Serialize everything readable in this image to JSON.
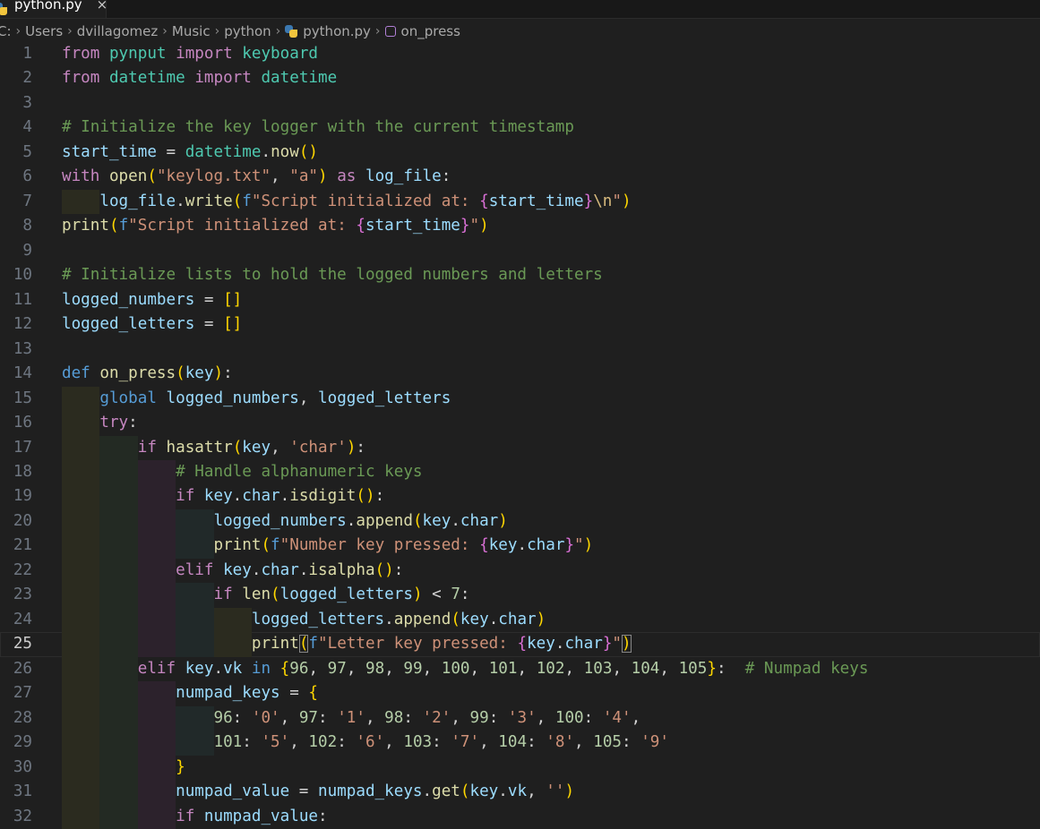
{
  "tab": {
    "label": "python.py",
    "close": "×"
  },
  "breadcrumb": [
    "C:",
    "Users",
    "dvillagomez",
    "Music",
    "python",
    "python.py",
    "on_press"
  ],
  "current_line": 25,
  "indent_colors": [
    "#2b2b1f",
    "#232a23",
    "#2c222c",
    "#212929"
  ],
  "lines": [
    [
      [
        "k",
        "from"
      ],
      [
        "p",
        " "
      ],
      [
        "m",
        "pynput"
      ],
      [
        "p",
        " "
      ],
      [
        "k",
        "import"
      ],
      [
        "p",
        " "
      ],
      [
        "m",
        "keyboard"
      ]
    ],
    [
      [
        "k",
        "from"
      ],
      [
        "p",
        " "
      ],
      [
        "m",
        "datetime"
      ],
      [
        "p",
        " "
      ],
      [
        "k",
        "import"
      ],
      [
        "p",
        " "
      ],
      [
        "m",
        "datetime"
      ]
    ],
    [],
    [
      [
        "c",
        "# Initialize the key logger with the current timestamp"
      ]
    ],
    [
      [
        "v",
        "start_time"
      ],
      [
        "p",
        " = "
      ],
      [
        "m",
        "datetime"
      ],
      [
        "p",
        "."
      ],
      [
        "f",
        "now"
      ],
      [
        "b1",
        "()"
      ]
    ],
    [
      [
        "k",
        "with"
      ],
      [
        "p",
        " "
      ],
      [
        "f",
        "open"
      ],
      [
        "b1",
        "("
      ],
      [
        "s",
        "\"keylog.txt\""
      ],
      [
        "p",
        ", "
      ],
      [
        "s",
        "\"a\""
      ],
      [
        "b1",
        ")"
      ],
      [
        "p",
        " "
      ],
      [
        "k",
        "as"
      ],
      [
        "p",
        " "
      ],
      [
        "v",
        "log_file"
      ],
      [
        "p",
        ":"
      ]
    ],
    [
      [
        "p",
        "    "
      ],
      [
        "v",
        "log_file"
      ],
      [
        "p",
        "."
      ],
      [
        "f",
        "write"
      ],
      [
        "b1",
        "("
      ],
      [
        "d",
        "f"
      ],
      [
        "s",
        "\"Script initialized at: "
      ],
      [
        "b2",
        "{"
      ],
      [
        "v",
        "start_time"
      ],
      [
        "b2",
        "}"
      ],
      [
        "e",
        "\\n"
      ],
      [
        "s",
        "\""
      ],
      [
        "b1",
        ")"
      ]
    ],
    [
      [
        "f",
        "print"
      ],
      [
        "b1",
        "("
      ],
      [
        "d",
        "f"
      ],
      [
        "s",
        "\"Script initialized at: "
      ],
      [
        "b2",
        "{"
      ],
      [
        "v",
        "start_time"
      ],
      [
        "b2",
        "}"
      ],
      [
        "s",
        "\""
      ],
      [
        "b1",
        ")"
      ]
    ],
    [],
    [
      [
        "c",
        "# Initialize lists to hold the logged numbers and letters"
      ]
    ],
    [
      [
        "v",
        "logged_numbers"
      ],
      [
        "p",
        " = "
      ],
      [
        "b1",
        "[]"
      ]
    ],
    [
      [
        "v",
        "logged_letters"
      ],
      [
        "p",
        " = "
      ],
      [
        "b1",
        "[]"
      ]
    ],
    [],
    [
      [
        "d",
        "def"
      ],
      [
        "p",
        " "
      ],
      [
        "f",
        "on_press"
      ],
      [
        "b1",
        "("
      ],
      [
        "v",
        "key"
      ],
      [
        "b1",
        ")"
      ],
      [
        "p",
        ":"
      ]
    ],
    [
      [
        "p",
        "    "
      ],
      [
        "d",
        "global"
      ],
      [
        "p",
        " "
      ],
      [
        "v",
        "logged_numbers"
      ],
      [
        "p",
        ", "
      ],
      [
        "v",
        "logged_letters"
      ]
    ],
    [
      [
        "p",
        "    "
      ],
      [
        "k",
        "try"
      ],
      [
        "p",
        ":"
      ]
    ],
    [
      [
        "p",
        "        "
      ],
      [
        "k",
        "if"
      ],
      [
        "p",
        " "
      ],
      [
        "f",
        "hasattr"
      ],
      [
        "b1",
        "("
      ],
      [
        "v",
        "key"
      ],
      [
        "p",
        ", "
      ],
      [
        "s",
        "'char'"
      ],
      [
        "b1",
        ")"
      ],
      [
        "p",
        ":"
      ]
    ],
    [
      [
        "p",
        "            "
      ],
      [
        "c",
        "# Handle alphanumeric keys"
      ]
    ],
    [
      [
        "p",
        "            "
      ],
      [
        "k",
        "if"
      ],
      [
        "p",
        " "
      ],
      [
        "v",
        "key"
      ],
      [
        "p",
        "."
      ],
      [
        "v",
        "char"
      ],
      [
        "p",
        "."
      ],
      [
        "f",
        "isdigit"
      ],
      [
        "b1",
        "()"
      ],
      [
        "p",
        ":"
      ]
    ],
    [
      [
        "p",
        "                "
      ],
      [
        "v",
        "logged_numbers"
      ],
      [
        "p",
        "."
      ],
      [
        "f",
        "append"
      ],
      [
        "b1",
        "("
      ],
      [
        "v",
        "key"
      ],
      [
        "p",
        "."
      ],
      [
        "v",
        "char"
      ],
      [
        "b1",
        ")"
      ]
    ],
    [
      [
        "p",
        "                "
      ],
      [
        "f",
        "print"
      ],
      [
        "b1",
        "("
      ],
      [
        "d",
        "f"
      ],
      [
        "s",
        "\"Number key pressed: "
      ],
      [
        "b2",
        "{"
      ],
      [
        "v",
        "key"
      ],
      [
        "p",
        "."
      ],
      [
        "v",
        "char"
      ],
      [
        "b2",
        "}"
      ],
      [
        "s",
        "\""
      ],
      [
        "b1",
        ")"
      ]
    ],
    [
      [
        "p",
        "            "
      ],
      [
        "k",
        "elif"
      ],
      [
        "p",
        " "
      ],
      [
        "v",
        "key"
      ],
      [
        "p",
        "."
      ],
      [
        "v",
        "char"
      ],
      [
        "p",
        "."
      ],
      [
        "f",
        "isalpha"
      ],
      [
        "b1",
        "()"
      ],
      [
        "p",
        ":"
      ]
    ],
    [
      [
        "p",
        "                "
      ],
      [
        "k",
        "if"
      ],
      [
        "p",
        " "
      ],
      [
        "f",
        "len"
      ],
      [
        "b1",
        "("
      ],
      [
        "v",
        "logged_letters"
      ],
      [
        "b1",
        ")"
      ],
      [
        "p",
        " < "
      ],
      [
        "n",
        "7"
      ],
      [
        "p",
        ":"
      ]
    ],
    [
      [
        "p",
        "                    "
      ],
      [
        "v",
        "logged_letters"
      ],
      [
        "p",
        "."
      ],
      [
        "f",
        "append"
      ],
      [
        "b1",
        "("
      ],
      [
        "v",
        "key"
      ],
      [
        "p",
        "."
      ],
      [
        "v",
        "char"
      ],
      [
        "b1",
        ")"
      ]
    ],
    [
      [
        "p",
        "                    "
      ],
      [
        "f",
        "print"
      ],
      [
        "b1m",
        "("
      ],
      [
        "d",
        "f"
      ],
      [
        "s",
        "\"Letter key pressed: "
      ],
      [
        "b2",
        "{"
      ],
      [
        "v",
        "key"
      ],
      [
        "p",
        "."
      ],
      [
        "v",
        "char"
      ],
      [
        "b2",
        "}"
      ],
      [
        "s",
        "\""
      ],
      [
        "b1m",
        ")"
      ]
    ],
    [
      [
        "p",
        "        "
      ],
      [
        "k",
        "elif"
      ],
      [
        "p",
        " "
      ],
      [
        "v",
        "key"
      ],
      [
        "p",
        "."
      ],
      [
        "v",
        "vk"
      ],
      [
        "p",
        " "
      ],
      [
        "d",
        "in"
      ],
      [
        "p",
        " "
      ],
      [
        "b1",
        "{"
      ],
      [
        "n",
        "96"
      ],
      [
        "p",
        ", "
      ],
      [
        "n",
        "97"
      ],
      [
        "p",
        ", "
      ],
      [
        "n",
        "98"
      ],
      [
        "p",
        ", "
      ],
      [
        "n",
        "99"
      ],
      [
        "p",
        ", "
      ],
      [
        "n",
        "100"
      ],
      [
        "p",
        ", "
      ],
      [
        "n",
        "101"
      ],
      [
        "p",
        ", "
      ],
      [
        "n",
        "102"
      ],
      [
        "p",
        ", "
      ],
      [
        "n",
        "103"
      ],
      [
        "p",
        ", "
      ],
      [
        "n",
        "104"
      ],
      [
        "p",
        ", "
      ],
      [
        "n",
        "105"
      ],
      [
        "b1",
        "}"
      ],
      [
        "p",
        ":  "
      ],
      [
        "c",
        "# Numpad keys"
      ]
    ],
    [
      [
        "p",
        "            "
      ],
      [
        "v",
        "numpad_keys"
      ],
      [
        "p",
        " = "
      ],
      [
        "b1",
        "{"
      ]
    ],
    [
      [
        "p",
        "                "
      ],
      [
        "n",
        "96"
      ],
      [
        "p",
        ": "
      ],
      [
        "s",
        "'0'"
      ],
      [
        "p",
        ", "
      ],
      [
        "n",
        "97"
      ],
      [
        "p",
        ": "
      ],
      [
        "s",
        "'1'"
      ],
      [
        "p",
        ", "
      ],
      [
        "n",
        "98"
      ],
      [
        "p",
        ": "
      ],
      [
        "s",
        "'2'"
      ],
      [
        "p",
        ", "
      ],
      [
        "n",
        "99"
      ],
      [
        "p",
        ": "
      ],
      [
        "s",
        "'3'"
      ],
      [
        "p",
        ", "
      ],
      [
        "n",
        "100"
      ],
      [
        "p",
        ": "
      ],
      [
        "s",
        "'4'"
      ],
      [
        "p",
        ","
      ]
    ],
    [
      [
        "p",
        "                "
      ],
      [
        "n",
        "101"
      ],
      [
        "p",
        ": "
      ],
      [
        "s",
        "'5'"
      ],
      [
        "p",
        ", "
      ],
      [
        "n",
        "102"
      ],
      [
        "p",
        ": "
      ],
      [
        "s",
        "'6'"
      ],
      [
        "p",
        ", "
      ],
      [
        "n",
        "103"
      ],
      [
        "p",
        ": "
      ],
      [
        "s",
        "'7'"
      ],
      [
        "p",
        ", "
      ],
      [
        "n",
        "104"
      ],
      [
        "p",
        ": "
      ],
      [
        "s",
        "'8'"
      ],
      [
        "p",
        ", "
      ],
      [
        "n",
        "105"
      ],
      [
        "p",
        ": "
      ],
      [
        "s",
        "'9'"
      ]
    ],
    [
      [
        "p",
        "            "
      ],
      [
        "b1",
        "}"
      ]
    ],
    [
      [
        "p",
        "            "
      ],
      [
        "v",
        "numpad_value"
      ],
      [
        "p",
        " = "
      ],
      [
        "v",
        "numpad_keys"
      ],
      [
        "p",
        "."
      ],
      [
        "f",
        "get"
      ],
      [
        "b1",
        "("
      ],
      [
        "v",
        "key"
      ],
      [
        "p",
        "."
      ],
      [
        "v",
        "vk"
      ],
      [
        "p",
        ", "
      ],
      [
        "s",
        "''"
      ],
      [
        "b1",
        ")"
      ]
    ],
    [
      [
        "p",
        "            "
      ],
      [
        "k",
        "if"
      ],
      [
        "p",
        " "
      ],
      [
        "v",
        "numpad_value"
      ],
      [
        "p",
        ":"
      ]
    ]
  ]
}
